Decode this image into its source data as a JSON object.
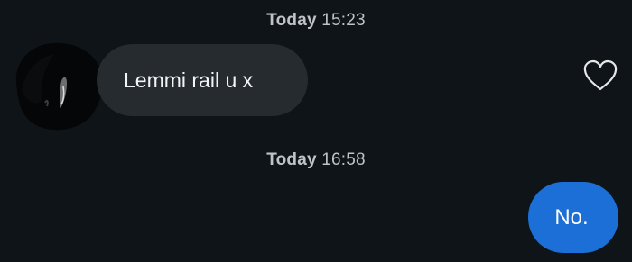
{
  "conversation": {
    "messages_groups": [
      {
        "timestamp_day": "Today",
        "timestamp_time": "15:23"
      },
      {
        "timestamp_day": "Today",
        "timestamp_time": "16:58"
      }
    ],
    "incoming_message": {
      "text": "Lemmi rail u x",
      "like_icon": "heart-outline-icon"
    },
    "outgoing_message": {
      "text": "No."
    }
  },
  "colors": {
    "background": "#0e1418",
    "incoming_bubble": "#262b30",
    "outgoing_bubble": "#1c6fd6",
    "timestamp_text": "#bfc3c6"
  }
}
